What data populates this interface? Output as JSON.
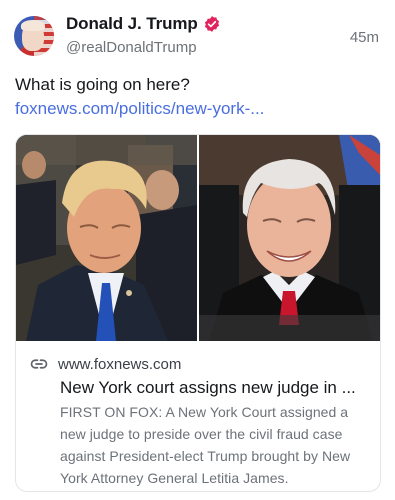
{
  "author": {
    "display_name": "Donald J. Trump",
    "handle": "@realDonaldTrump",
    "timestamp": "45m",
    "avatar_icon": "avatar-portrait",
    "verified_icon": "verified-badge-icon",
    "verified_color": "#e0245e"
  },
  "post": {
    "text": "What is going on here?",
    "link_text": "foxnews.com/politics/new-york-...",
    "link_color": "#4a6ee0"
  },
  "card": {
    "image_left_alt": "photo-of-trump-in-court",
    "image_right_alt": "photo-of-judge-smiling",
    "link_icon": "link-icon",
    "domain": "www.foxnews.com",
    "title": "New York court assigns new judge in ...",
    "description": "FIRST ON FOX: A New York Court assigned a new judge to preside over the civil fraud case against President-elect Trump brought by New York Attorney General Letitia James."
  }
}
